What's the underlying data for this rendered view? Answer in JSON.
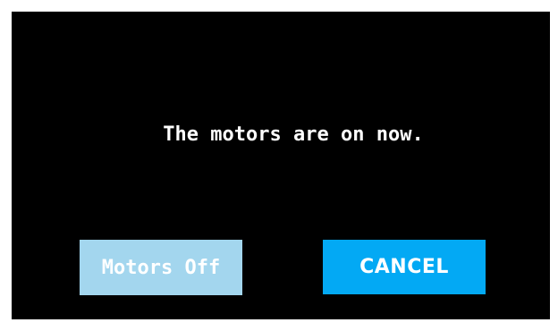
{
  "dialog": {
    "message": "The motors are on now.",
    "buttons": {
      "motors_off": "Motors Off",
      "cancel": "CANCEL"
    }
  },
  "colors": {
    "background": "#000000",
    "motors_off_button": "#a3d6ee",
    "cancel_button": "#03a9f4",
    "text": "#ffffff"
  }
}
